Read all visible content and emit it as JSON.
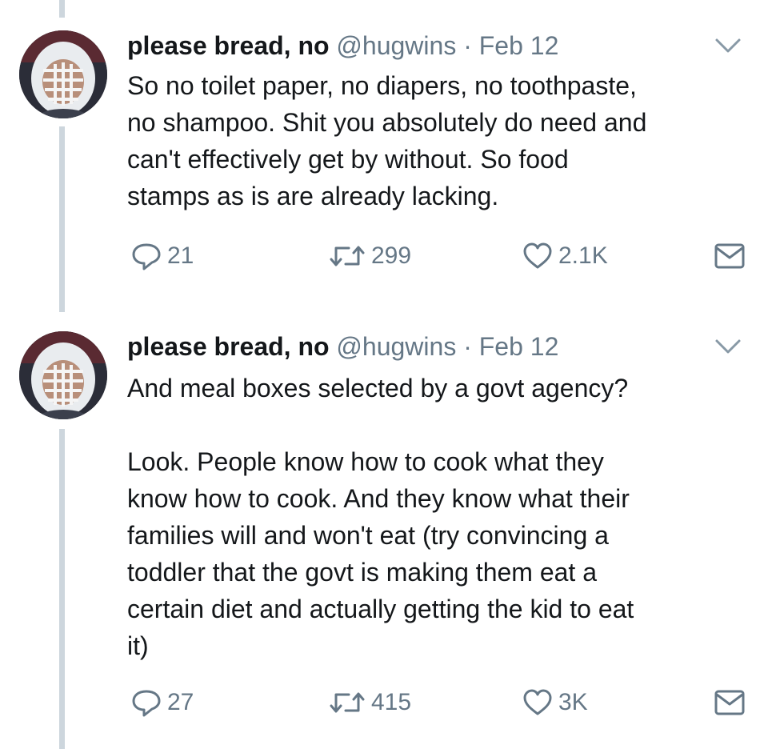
{
  "tweets": [
    {
      "name": "please bread, no",
      "handle": "@hugwins",
      "separator": "·",
      "date": "Feb 12",
      "text": "So no toilet paper, no diapers, no toothpaste,\nno shampoo. Shit you absolutely do need and\ncan't effectively get by without. So food\nstamps as is are already lacking.",
      "replies": "21",
      "retweets": "299",
      "likes": "2.1K"
    },
    {
      "name": "please bread, no",
      "handle": "@hugwins",
      "separator": "·",
      "date": "Feb 12",
      "text": "And meal boxes selected by a govt agency?\n\nLook. People know how to cook what they\nknow how to cook. And they know what their\nfamilies will and won't eat (try convincing a\ntoddler that the govt is making them eat a\ncertain diet and actually getting the kid to eat\nit)",
      "replies": "27",
      "retweets": "415",
      "likes": "3K"
    }
  ],
  "icons": {
    "reply": "reply-icon",
    "retweet": "retweet-icon",
    "like": "heart-icon",
    "message": "envelope-icon",
    "caret": "chevron-down-icon"
  },
  "colors": {
    "text": "#14171a",
    "muted": "#657786",
    "thread_line": "#cdd6dd"
  }
}
